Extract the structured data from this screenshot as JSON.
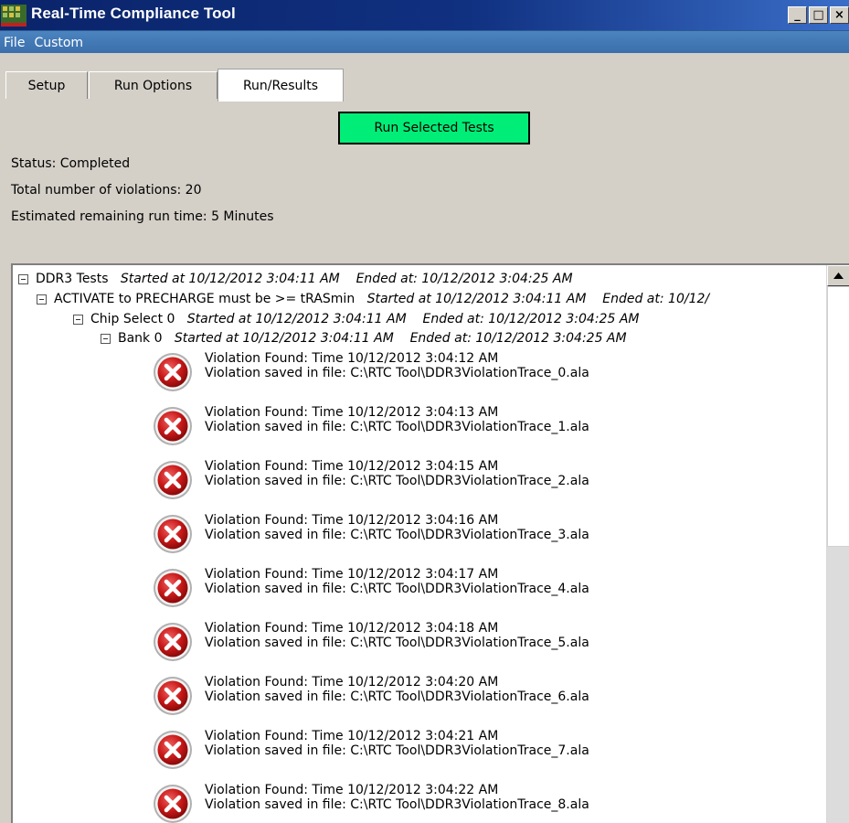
{
  "window": {
    "title": "Real-Time Compliance Tool",
    "min_glyph": "_",
    "max_glyph": "□",
    "close_glyph": "×"
  },
  "menu": {
    "items": [
      "File",
      "Custom"
    ]
  },
  "tabs": [
    {
      "label": "Setup",
      "active": false
    },
    {
      "label": "Run Options",
      "active": false
    },
    {
      "label": "Run/Results",
      "active": true
    }
  ],
  "run_button": {
    "label": "Run Selected Tests",
    "color": "#00ee77"
  },
  "status": {
    "status_line": "Status: Completed",
    "violations_line": "Total number of violations: 20",
    "remaining_line": "Estimated remaining run time: 5 Minutes"
  },
  "tree": {
    "root": {
      "label": "DDR3 Tests",
      "timing": "Started at 10/12/2012 3:04:11 AM    Ended at: 10/12/2012 3:04:25 AM"
    },
    "rule": {
      "label": "ACTIVATE to PRECHARGE must be >= tRASmin",
      "timing": "Started at 10/12/2012 3:04:11 AM    Ended at: 10/12/"
    },
    "chip": {
      "label": "Chip Select 0",
      "timing": "Started at 10/12/2012 3:04:11 AM    Ended at: 10/12/2012 3:04:25 AM"
    },
    "bank": {
      "label": "Bank 0",
      "timing": "Started at 10/12/2012 3:04:11 AM    Ended at: 10/12/2012 3:04:25 AM"
    },
    "violations": [
      {
        "line1": "Violation Found: Time  10/12/2012 3:04:12 AM",
        "line2": "Violation saved in file:  C:\\RTC Tool\\DDR3ViolationTrace_0.ala"
      },
      {
        "line1": "Violation Found: Time  10/12/2012 3:04:13 AM",
        "line2": "Violation saved in file:  C:\\RTC Tool\\DDR3ViolationTrace_1.ala"
      },
      {
        "line1": "Violation Found: Time  10/12/2012 3:04:15 AM",
        "line2": "Violation saved in file:  C:\\RTC Tool\\DDR3ViolationTrace_2.ala"
      },
      {
        "line1": "Violation Found: Time  10/12/2012 3:04:16 AM",
        "line2": "Violation saved in file:  C:\\RTC Tool\\DDR3ViolationTrace_3.ala"
      },
      {
        "line1": "Violation Found: Time  10/12/2012 3:04:17 AM",
        "line2": "Violation saved in file:  C:\\RTC Tool\\DDR3ViolationTrace_4.ala"
      },
      {
        "line1": "Violation Found: Time  10/12/2012 3:04:18 AM",
        "line2": "Violation saved in file:  C:\\RTC Tool\\DDR3ViolationTrace_5.ala"
      },
      {
        "line1": "Violation Found: Time  10/12/2012 3:04:20 AM",
        "line2": "Violation saved in file:  C:\\RTC Tool\\DDR3ViolationTrace_6.ala"
      },
      {
        "line1": "Violation Found: Time  10/12/2012 3:04:21 AM",
        "line2": "Violation saved in file:  C:\\RTC Tool\\DDR3ViolationTrace_7.ala"
      },
      {
        "line1": "Violation Found: Time  10/12/2012 3:04:22 AM",
        "line2": "Violation saved in file:  C:\\RTC Tool\\DDR3ViolationTrace_8.ala"
      }
    ]
  }
}
